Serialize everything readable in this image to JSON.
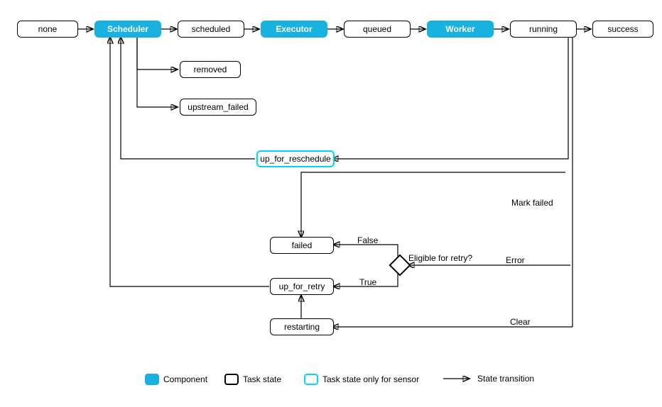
{
  "nodes": {
    "none": {
      "label": "none",
      "type": "state"
    },
    "scheduler": {
      "label": "Scheduler",
      "type": "component"
    },
    "scheduled": {
      "label": "scheduled",
      "type": "state"
    },
    "executor": {
      "label": "Executor",
      "type": "component"
    },
    "queued": {
      "label": "queued",
      "type": "state"
    },
    "worker": {
      "label": "Worker",
      "type": "component"
    },
    "running": {
      "label": "running",
      "type": "state"
    },
    "success": {
      "label": "success",
      "type": "state"
    },
    "removed": {
      "label": "removed",
      "type": "state"
    },
    "upstream_failed": {
      "label": "upstream_failed",
      "type": "state"
    },
    "up_for_reschedule": {
      "label": "up_for_reschedule",
      "type": "sensor-state"
    },
    "failed": {
      "label": "failed",
      "type": "state"
    },
    "up_for_retry": {
      "label": "up_for_retry",
      "type": "state"
    },
    "restarting": {
      "label": "restarting",
      "type": "state"
    },
    "decision": {
      "label": "Eligible for retry?",
      "type": "decision"
    }
  },
  "edges": [
    {
      "from": "none",
      "to": "scheduler"
    },
    {
      "from": "scheduler",
      "to": "scheduled"
    },
    {
      "from": "scheduled",
      "to": "executor"
    },
    {
      "from": "executor",
      "to": "queued"
    },
    {
      "from": "queued",
      "to": "worker"
    },
    {
      "from": "worker",
      "to": "running"
    },
    {
      "from": "running",
      "to": "success"
    },
    {
      "from": "scheduler",
      "to": "removed"
    },
    {
      "from": "scheduler",
      "to": "upstream_failed"
    },
    {
      "from": "running",
      "to": "up_for_reschedule"
    },
    {
      "from": "up_for_reschedule",
      "to": "scheduler"
    },
    {
      "from": "running",
      "to": "failed",
      "label": "Mark failed"
    },
    {
      "from": "running",
      "to": "decision",
      "label": "Error"
    },
    {
      "from": "decision",
      "to": "failed",
      "label": "False"
    },
    {
      "from": "decision",
      "to": "up_for_retry",
      "label": "True"
    },
    {
      "from": "up_for_retry",
      "to": "scheduler"
    },
    {
      "from": "running",
      "to": "restarting",
      "label": "Clear"
    },
    {
      "from": "restarting",
      "to": "up_for_retry"
    }
  ],
  "legend": {
    "component": "Component",
    "state": "Task state",
    "sensor_state": "Task state only for sensor",
    "transition": "State transition"
  }
}
